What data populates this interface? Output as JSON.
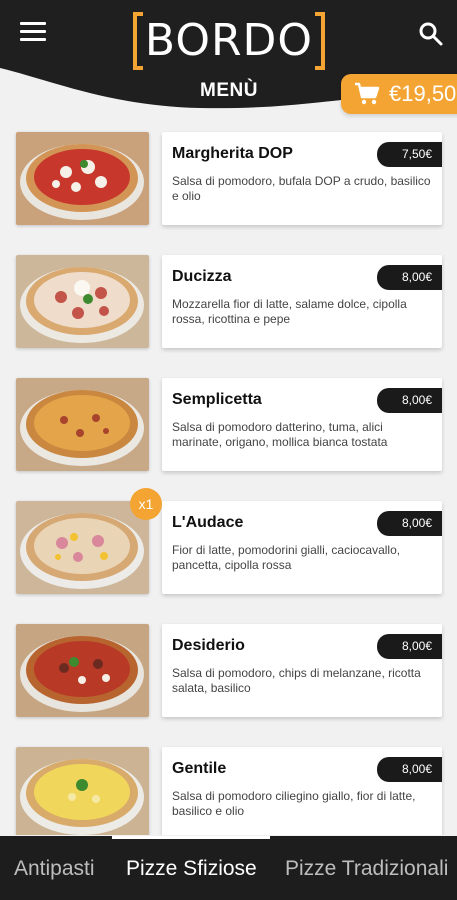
{
  "header": {
    "logo_text": "BORDO",
    "title": "MENÙ",
    "menu_icon": "hamburger-icon",
    "search_icon": "search-icon",
    "cart": {
      "icon": "cart-icon",
      "total": "€19,50"
    },
    "colors": {
      "background": "#1f1f1f",
      "accent": "#f3a432"
    }
  },
  "items": [
    {
      "name": "Margherita DOP",
      "price": "7,50€",
      "description": "Salsa di pomodoro, bufala DOP a crudo, basilico e olio"
    },
    {
      "name": "Ducizza",
      "price": "8,00€",
      "description": "Mozzarella fior di latte, salame dolce, cipolla rossa, ricottina e pepe"
    },
    {
      "name": "Semplicetta",
      "price": "8,00€",
      "description": "Salsa di pomodoro datterino, tuma, alici marinate, origano, mollica bianca tostata"
    },
    {
      "name": "L'Audace",
      "price": "8,00€",
      "description": "Fior di latte, pomodorini gialli, caciocavallo, pancetta, cipolla rossa",
      "quantity": "x1"
    },
    {
      "name": "Desiderio",
      "price": "8,00€",
      "description": "Salsa di pomodoro, chips di melanzane, ricotta salata, basilico"
    },
    {
      "name": "Gentile",
      "price": "8,00€",
      "description": "Salsa di pomodoro ciliegino giallo, fior di latte, basilico e olio"
    }
  ],
  "tabs": [
    {
      "label": "Antipasti"
    },
    {
      "label": "Pizze Sfiziose",
      "active": true
    },
    {
      "label": "Pizze Tradizionali"
    }
  ]
}
